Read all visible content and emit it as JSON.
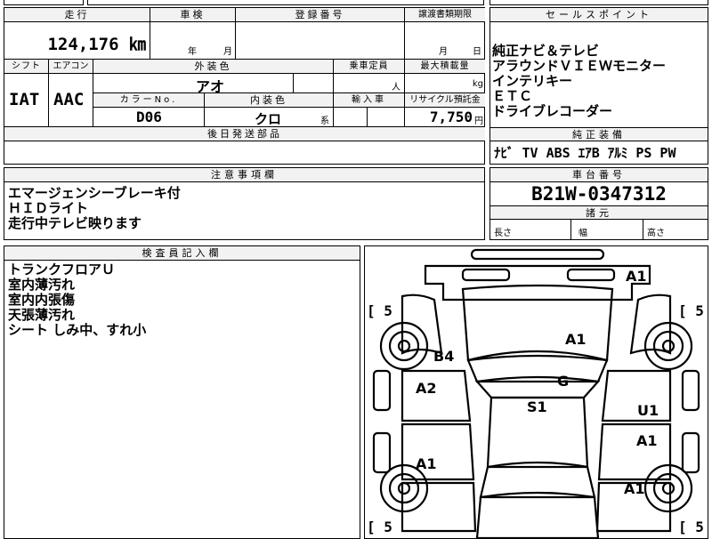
{
  "top_strip": {
    "partial_text": "..."
  },
  "mileage": {
    "label": "走行",
    "value": "124,176 ㎞"
  },
  "inspection": {
    "label": "車検",
    "year": "年",
    "month": "月"
  },
  "registration": {
    "label": "登録番号"
  },
  "transfer": {
    "label": "譲渡書類期限",
    "month": "月",
    "day": "日"
  },
  "shift": {
    "label": "シフト",
    "value": "IAT"
  },
  "aircon": {
    "label": "エアコン",
    "value": "AAC"
  },
  "exterior_color": {
    "label": "外装色",
    "value": "アオ"
  },
  "color_no": {
    "label": "カラーNo.",
    "value": "D06"
  },
  "interior_color": {
    "label": "内装色",
    "value": "クロ",
    "suffix": "系"
  },
  "capacity": {
    "label": "乗車定員",
    "unit": "人"
  },
  "max_load": {
    "label": "最大積載量",
    "unit": "kg"
  },
  "import": {
    "label": "輸入車"
  },
  "recycle": {
    "label": "リサイクル預託金",
    "value": "7,750",
    "unit": "円"
  },
  "later_parts": {
    "label": "後日発送部品"
  },
  "sales_points": {
    "label": "セールスポイント",
    "items": [
      "純正ナビ＆テレビ",
      "アラウンドＶＩＥＷモニター",
      "インテリキー",
      "ＥＴＣ",
      "ドライブレコーダー"
    ]
  },
  "genuine_equipment": {
    "label": "純正装備",
    "value": "ﾅﾋﾞ TV ABS ｴｱB ｱﾙﾐ PS PW"
  },
  "notes": {
    "label": "注意事項欄",
    "lines": [
      "エマージェンシーブレーキ付",
      "ＨＩＤライト",
      "走行中テレビ映ります"
    ]
  },
  "chassis": {
    "label": "車台番号",
    "value": "B21W-0347312"
  },
  "specs": {
    "label": "諸元",
    "length": "長さ",
    "width": "幅",
    "height": "高さ"
  },
  "inspector": {
    "label": "検査員記入欄",
    "lines": [
      "トランクフロアＵ",
      "室内薄汚れ",
      "室内内張傷",
      "天張薄汚れ",
      "シート しみ中、すれ小"
    ]
  },
  "diagram": {
    "damage": {
      "a1_top": "A1",
      "a1_hood": "A1",
      "b4": "B4",
      "g": "G",
      "a2": "A2",
      "s1": "S1",
      "u1": "U1",
      "a1_rdoor": "A1",
      "a1_ldoor": "A1",
      "a1_rrear": "A1"
    },
    "tires": {
      "fl": "[ 5",
      "fr": "[ 5",
      "rl": "[ 5",
      "rr": "[ 5"
    }
  }
}
